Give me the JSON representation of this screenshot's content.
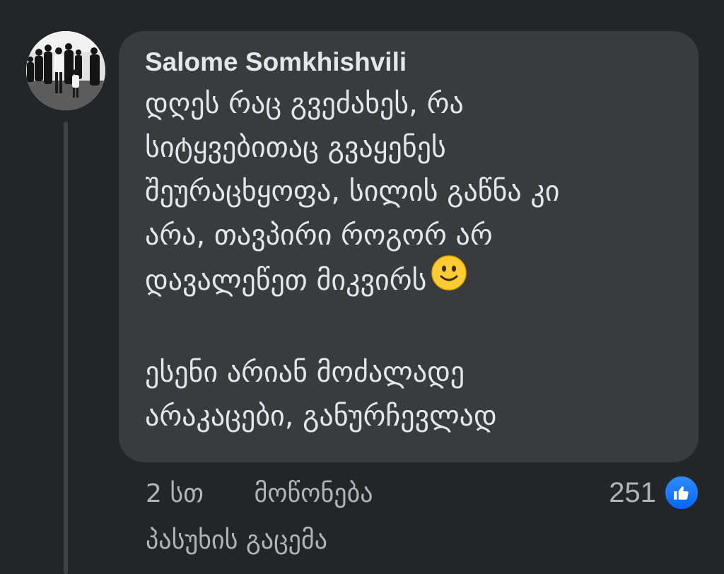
{
  "comment": {
    "author": "Salome Somkhishvili",
    "text_lines": [
      "დღეს რაც გვეძახეს, რა",
      "სიტყვებითაც გვაყენეს",
      "შეურაცხყოფა, სილის გაწნა კი",
      "არა, თავპირი როგორ არ",
      "დავალეწეთ მიკვირს",
      "",
      "ესენი არიან მოძალადე",
      "არაკაცები, განურჩევლად"
    ],
    "emoji": "slightly-smiling-face"
  },
  "meta": {
    "time": "2 სთ",
    "like_label": "მოწონება",
    "reply_label": "პასუხის გაცემა"
  },
  "reactions": {
    "count": "251",
    "icon": "like-icon",
    "badge_color": "#1877f2"
  },
  "colors": {
    "background": "#242526",
    "bubble": "#3a3b3c",
    "text_primary": "#e4e6eb",
    "text_secondary": "#b0b3b8"
  }
}
